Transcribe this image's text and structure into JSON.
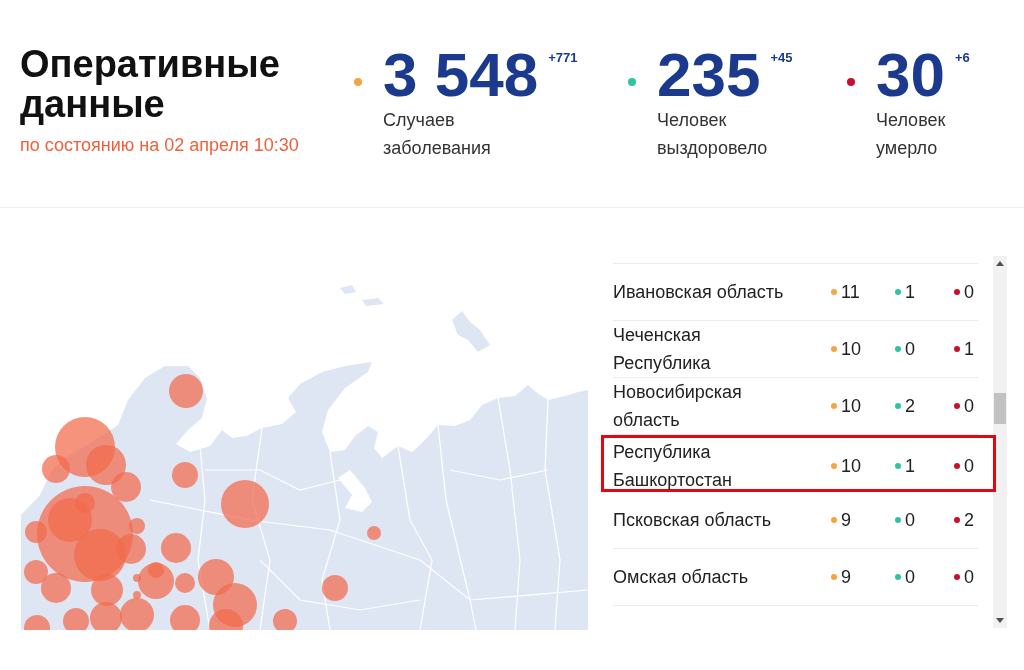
{
  "header": {
    "title": "Оперативные данные",
    "subtitle": "по состоянию на 02 апреля 10:30"
  },
  "stats": [
    {
      "color": "#f5a53f",
      "value": "3 548",
      "delta": "+771",
      "label": "Случаев заболевания"
    },
    {
      "color": "#2ec4a2",
      "value": "235",
      "delta": "+45",
      "label": "Человек выздоровело"
    },
    {
      "color": "#c8102e",
      "value": "30",
      "delta": "+6",
      "label": "Человек умерло"
    }
  ],
  "regions": [
    {
      "name": "Ивановская область",
      "counts": [
        "11",
        "1",
        "0"
      ],
      "highlighted": false
    },
    {
      "name": "Чеченская Республика",
      "counts": [
        "10",
        "0",
        "1"
      ],
      "highlighted": false
    },
    {
      "name": "Новосибирская область",
      "counts": [
        "10",
        "2",
        "0"
      ],
      "highlighted": false
    },
    {
      "name": "Республика Башкортостан",
      "counts": [
        "10",
        "1",
        "0"
      ],
      "highlighted": true
    },
    {
      "name": "Псковская область",
      "counts": [
        "9",
        "0",
        "2"
      ],
      "highlighted": false
    },
    {
      "name": "Омская область",
      "counts": [
        "9",
        "0",
        "0"
      ],
      "highlighted": false
    }
  ]
}
